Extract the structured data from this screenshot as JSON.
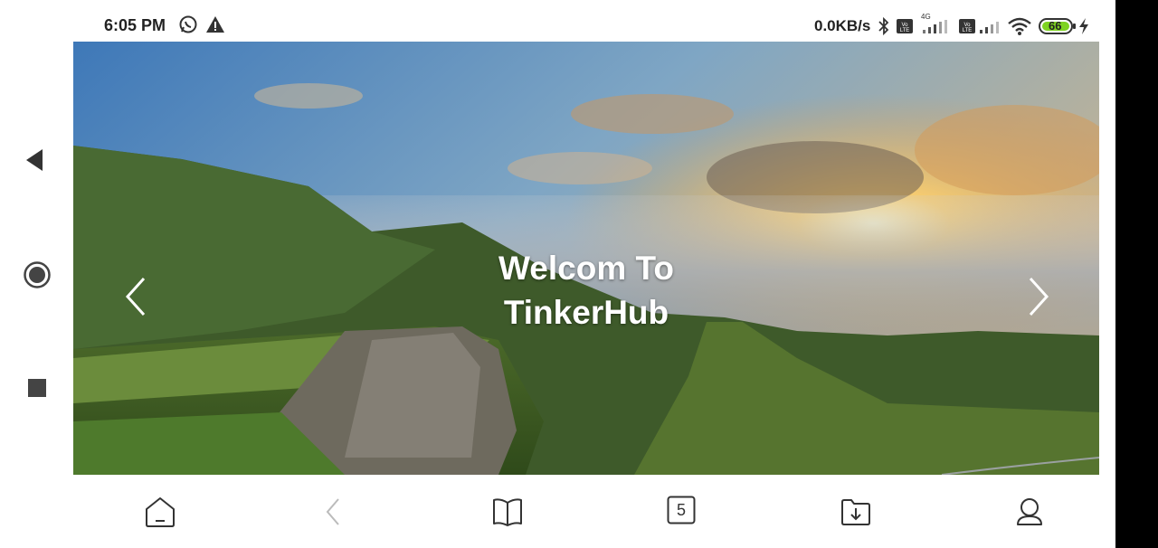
{
  "status_bar": {
    "time": "6:05 PM",
    "net_speed": "0.0KB/s",
    "network_type": "4G",
    "battery_level": "66"
  },
  "hero": {
    "title_line1": "Welcom To",
    "title_line2": "TinkerHub"
  },
  "bottom_bar": {
    "tab_count": "5"
  },
  "colors": {
    "status_text": "#222222",
    "battery_fill": "#7ed321",
    "icon_stroke": "#333333"
  }
}
